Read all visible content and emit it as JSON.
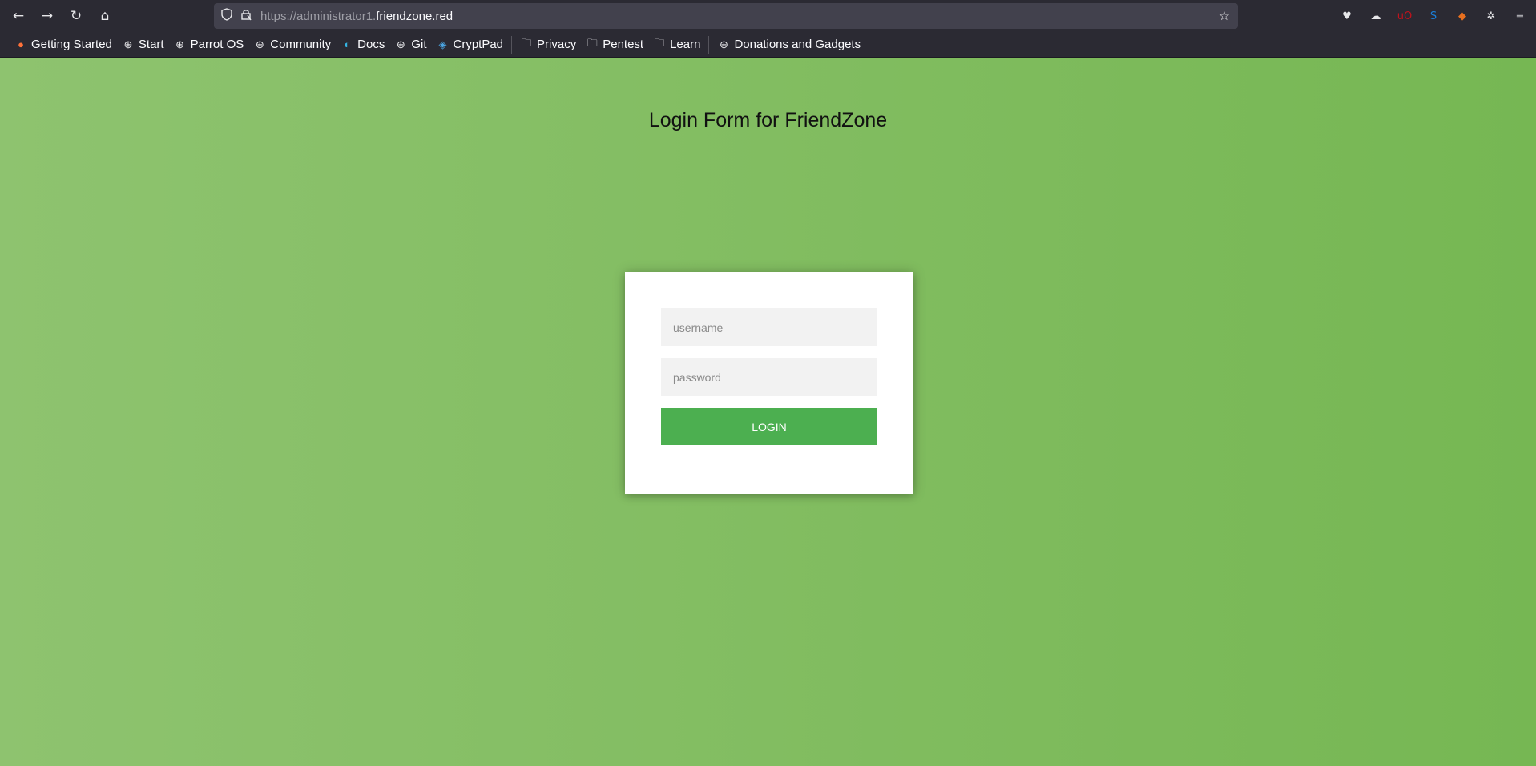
{
  "browser": {
    "url_prefix": "https://administrator1.",
    "url_host": "friendzone.red",
    "nav": [
      {
        "name": "back-icon",
        "glyph": "←"
      },
      {
        "name": "forward-icon",
        "glyph": "→"
      },
      {
        "name": "reload-icon",
        "glyph": "↻"
      },
      {
        "name": "home-icon",
        "glyph": "⌂"
      }
    ],
    "extensions": [
      {
        "name": "pocket-icon",
        "glyph": "♥",
        "color": "#e7e7ea"
      },
      {
        "name": "extension-squirrel-icon",
        "glyph": "☁",
        "color": "#e7e7ea"
      },
      {
        "name": "ublock-origin-icon",
        "glyph": "uO",
        "color": "#c1121c"
      },
      {
        "name": "s-extension-icon",
        "glyph": "S",
        "color": "#1a7fd9"
      },
      {
        "name": "fox-extension-icon",
        "glyph": "◆",
        "color": "#e76f1f"
      },
      {
        "name": "extensions-puzzle-icon",
        "glyph": "✲",
        "color": "#e7e7ea"
      },
      {
        "name": "menu-hamburger-icon",
        "glyph": "≡",
        "color": "#e7e7ea"
      }
    ]
  },
  "bookmarks": [
    {
      "label": "Getting Started",
      "icon": "firefox-icon"
    },
    {
      "label": "Start",
      "icon": "globe-icon"
    },
    {
      "label": "Parrot OS",
      "icon": "globe-icon"
    },
    {
      "label": "Community",
      "icon": "globe-icon"
    },
    {
      "label": "Docs",
      "icon": "docs-icon"
    },
    {
      "label": "Git",
      "icon": "globe-icon"
    },
    {
      "label": "CryptPad",
      "icon": "cryptpad-icon"
    },
    {
      "label": "Privacy",
      "icon": "folder-icon"
    },
    {
      "label": "Pentest",
      "icon": "folder-icon"
    },
    {
      "label": "Learn",
      "icon": "folder-icon"
    },
    {
      "label": "Donations and Gadgets",
      "icon": "globe-icon"
    }
  ],
  "page": {
    "title": "Login Form for FriendZone",
    "username_placeholder": "username",
    "password_placeholder": "password",
    "login_label": "LOGIN"
  }
}
